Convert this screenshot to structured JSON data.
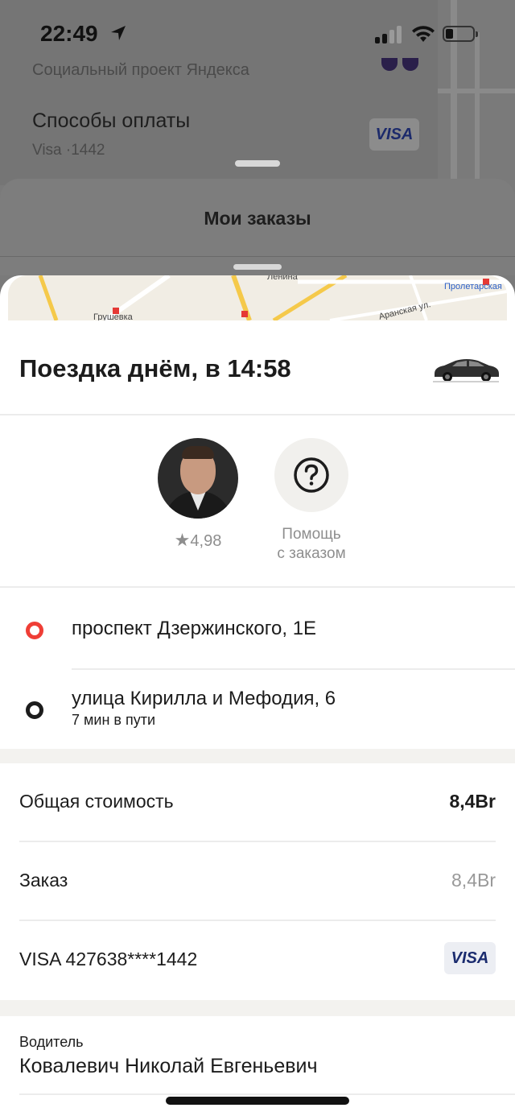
{
  "status_bar": {
    "time": "22:49"
  },
  "background": {
    "social_project": "Социальный проект Яндекса",
    "payment_methods_title": "Способы оплаты",
    "payment_methods_value": "Visa ·1442",
    "payment_badge": "VISA",
    "orders_title": "Мои заказы"
  },
  "map": {
    "labels": [
      "Ленина",
      "Пролетарская",
      "Грушевка",
      "Аранская ул."
    ]
  },
  "trip": {
    "title": "Поездка днём, в 14:58"
  },
  "driver_card": {
    "rating": "4,98",
    "help_line1": "Помощь",
    "help_line2": "с заказом"
  },
  "route": {
    "from": "проспект Дзержинского, 1Е",
    "to": "улица Кирилла и Мефодия, 6",
    "duration": "7 мин в пути"
  },
  "cost": {
    "total_label": "Общая стоимость",
    "total_value": "8,4Br",
    "order_label": "Заказ",
    "order_value": "8,4Br",
    "card_label": "VISA 427638****1442",
    "card_badge": "VISA"
  },
  "driver": {
    "label": "Водитель",
    "name": "Ковалевич Николай Евгеньевич"
  },
  "colors": {
    "accent_red": "#ef3e36",
    "visa_blue": "#1a2b6e"
  }
}
